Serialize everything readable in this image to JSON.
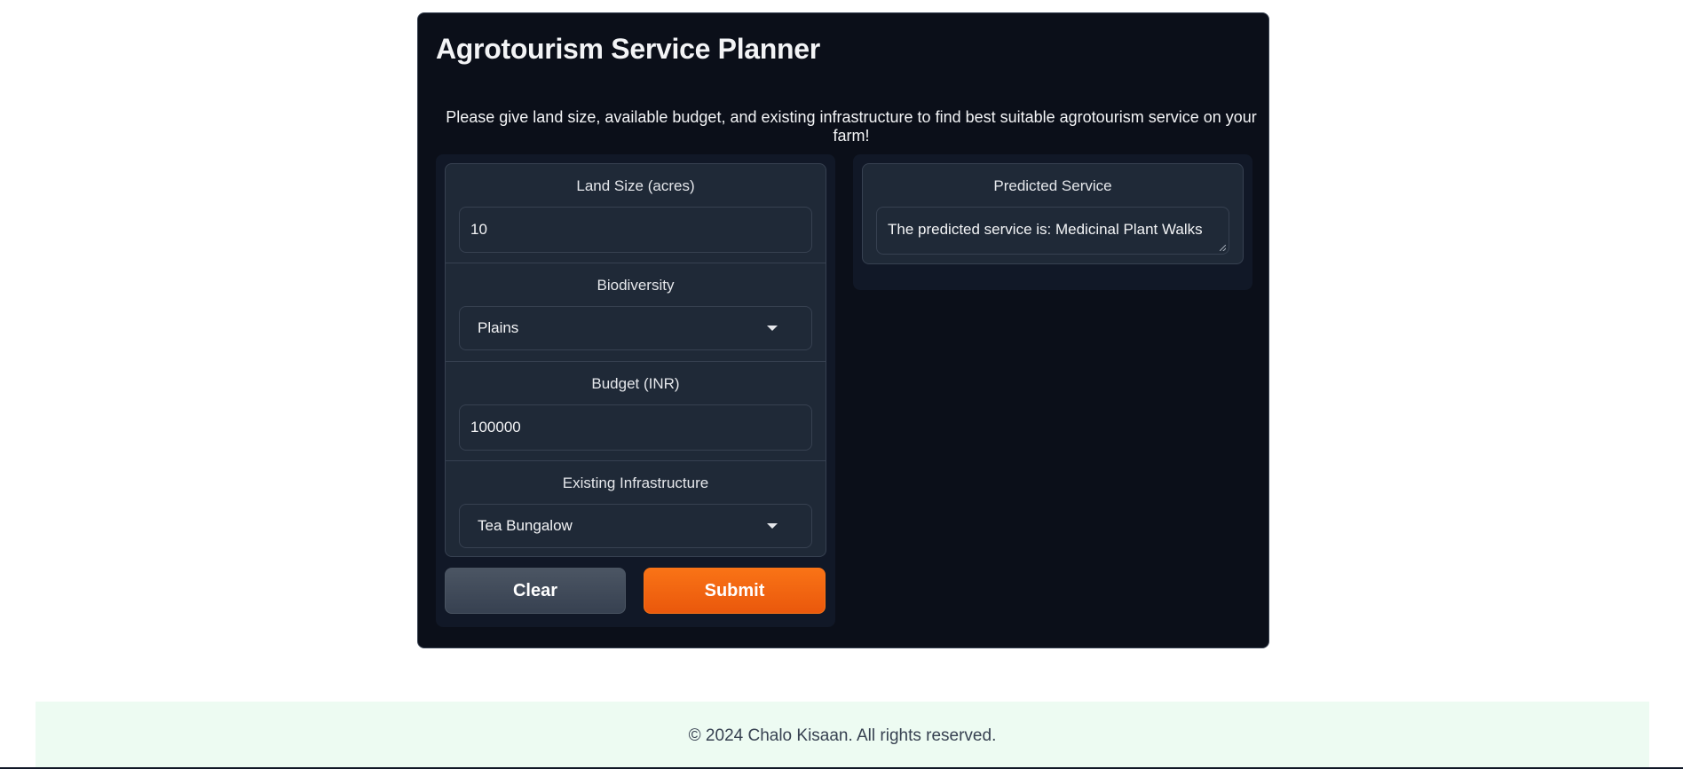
{
  "app": {
    "title": "Agrotourism Service Planner",
    "description": "Please give land size, available budget, and existing infrastructure to find best suitable agrotourism service on your farm!"
  },
  "inputs": {
    "land_size": {
      "label": "Land Size (acres)",
      "value": "10"
    },
    "biodiversity": {
      "label": "Biodiversity",
      "value": "Plains"
    },
    "budget": {
      "label": "Budget (INR)",
      "value": "100000"
    },
    "infrastructure": {
      "label": "Existing Infrastructure",
      "value": "Tea Bungalow"
    }
  },
  "buttons": {
    "clear_label": "Clear",
    "submit_label": "Submit"
  },
  "output": {
    "label": "Predicted Service",
    "value": "The predicted service is: Medicinal Plant Walks"
  },
  "footer": {
    "text": "© 2024 Chalo Kisaan. All rights reserved."
  },
  "colors": {
    "background": "#0b0f19",
    "panel": "#1f2937",
    "accent": "#f97316",
    "footer_bg": "#edfbf2"
  }
}
